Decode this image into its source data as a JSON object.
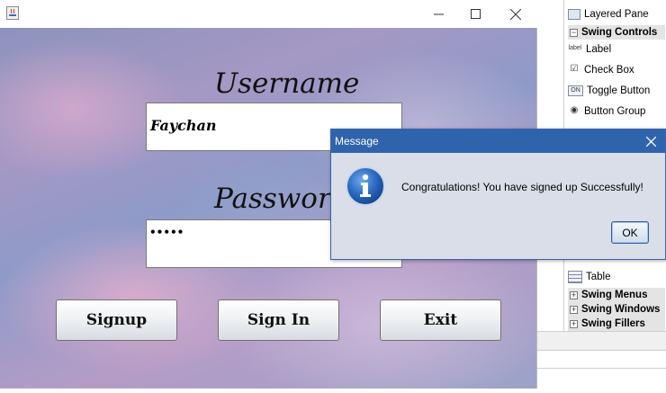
{
  "frame": {
    "username_label": "Username",
    "username_value": "Faychan",
    "password_label": "Password",
    "password_value": "•••••",
    "buttons": {
      "signup": "Signup",
      "signin": "Sign In",
      "exit": "Exit"
    }
  },
  "dialog": {
    "title": "Message",
    "message": "Congratulations! You have signed up Successfully!",
    "ok_label": "OK",
    "icon": "info-icon"
  },
  "palette": {
    "items_top": [
      {
        "label": "Layered Pane",
        "icon": "layered-pane-icon"
      }
    ],
    "category_swing_controls": "Swing Controls",
    "controls": [
      {
        "label": "Label",
        "icon": "label-icon",
        "icon_text": "label"
      },
      {
        "label": "Check Box",
        "icon": "checkbox-icon",
        "icon_text": "☑"
      },
      {
        "label": "Toggle Button",
        "icon": "toggle-button-icon",
        "icon_text": "ON"
      },
      {
        "label": "Button Group",
        "icon": "button-group-icon",
        "icon_text": "◉"
      }
    ],
    "table_item": {
      "label": "Table",
      "icon": "table-icon"
    },
    "categories_bottom": [
      "Swing Menus",
      "Swing Windows",
      "Swing Fillers"
    ]
  },
  "colors": {
    "dialog_title_bg": "#2f64ad",
    "dialog_bg": "#d9dee8",
    "info_icon_blue": "#1f5fb5"
  }
}
